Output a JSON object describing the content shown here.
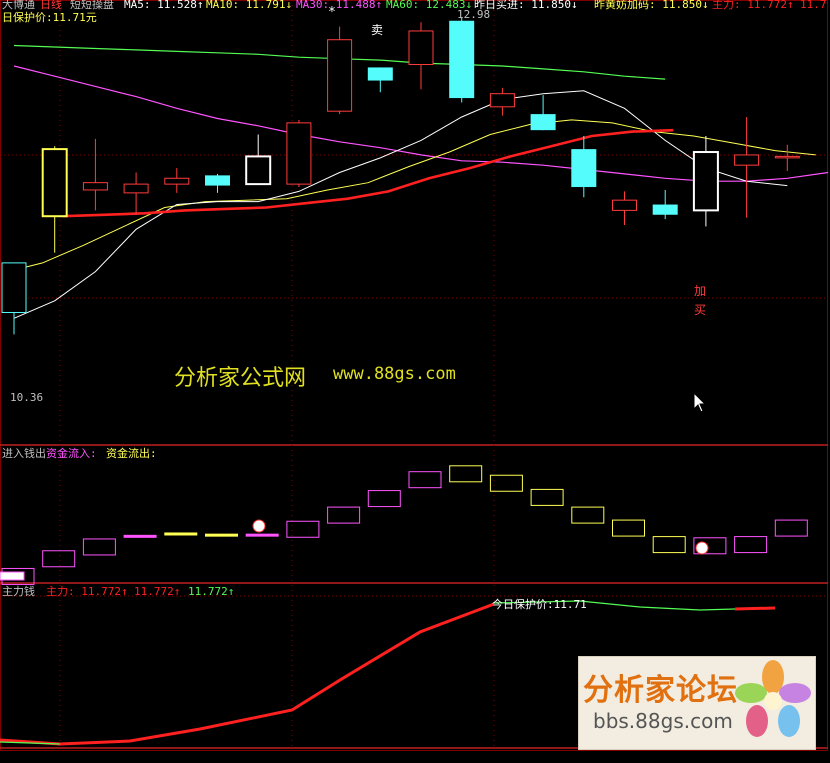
{
  "colors": {
    "up": "#ff3c3c",
    "down": "#54fcfc",
    "ma5": "#ffffff",
    "ma10": "#ffff54",
    "ma30": "#ff54ff",
    "ma60": "#54fc54",
    "red_line": "#ff2020",
    "grid": "#800000",
    "flow_in": "#ff54ff",
    "flow_out": "#ffff54",
    "zhuli": "#ff2020",
    "green": "#54fc54"
  },
  "header": {
    "title": "大博通",
    "period": "日线",
    "formula": "短短操盘",
    "ma5_label": "MA5: 11.528↑",
    "ma10_label": "MA10: 11.791↓",
    "ma30_label": "MA30: 11.488↑",
    "ma60_label": "MA60: 12.483↓",
    "buy_label": "昨日买进: 11.850↓",
    "add_label": "昨黄妨加码: 11.850↓",
    "zhuli_label": "主力: 11.772↑",
    "extra_label": "11.7",
    "protect_label": "日保护价:11.71元"
  },
  "annotations": {
    "sell": "卖",
    "add": "加",
    "buy": "买",
    "star": "*",
    "high": "12.98",
    "low": "10.36"
  },
  "panel2": {
    "title": "进入钱出",
    "in_label": "资金流入:",
    "out_label": "资金流出:"
  },
  "panel3": {
    "title": "主力钱",
    "v1": "主力: 11.772↑",
    "v2": "11.772↑",
    "v3": "11.772↑",
    "protect": "今日保护价:11.71"
  },
  "watermark": {
    "text": "分析家公式网",
    "url": "www.88gs.com"
  },
  "logo": {
    "title": "分析家论坛",
    "url": "bbs.88gs.com"
  },
  "chart_data": {
    "type": "candlestick",
    "candles": [
      {
        "o": 11.3,
        "c": 10.96,
        "h": 11.3,
        "l": 10.81
      },
      {
        "o": 11.62,
        "c": 12.08,
        "h": 12.1,
        "l": 11.37,
        "yellow": true
      },
      {
        "o": 11.8,
        "c": 11.85,
        "h": 12.15,
        "l": 11.66
      },
      {
        "o": 11.78,
        "c": 11.84,
        "h": 11.92,
        "l": 11.63
      },
      {
        "o": 11.84,
        "c": 11.88,
        "h": 11.95,
        "l": 11.78
      },
      {
        "o": 11.9,
        "c": 11.83,
        "h": 11.91,
        "l": 11.78,
        "cyan": true
      },
      {
        "o": 11.84,
        "c": 12.03,
        "h": 12.18,
        "l": 11.84,
        "white": true
      },
      {
        "o": 11.84,
        "c": 12.26,
        "h": 12.28,
        "l": 11.82
      },
      {
        "o": 12.34,
        "c": 12.83,
        "h": 12.92,
        "l": 12.32
      },
      {
        "o": 12.64,
        "c": 12.55,
        "h": 12.64,
        "l": 12.47,
        "cyan": true
      },
      {
        "o": 12.66,
        "c": 12.89,
        "h": 12.95,
        "l": 12.49
      },
      {
        "o": 12.96,
        "c": 12.43,
        "h": 12.98,
        "l": 12.4,
        "cyan": true
      },
      {
        "o": 12.37,
        "c": 12.46,
        "h": 12.5,
        "l": 12.31
      },
      {
        "o": 12.32,
        "c": 12.21,
        "h": 12.45,
        "l": 12.21,
        "cyan": true
      },
      {
        "o": 12.08,
        "c": 11.82,
        "h": 12.17,
        "l": 11.75,
        "cyan": true
      },
      {
        "o": 11.66,
        "c": 11.73,
        "h": 11.79,
        "l": 11.56
      },
      {
        "o": 11.7,
        "c": 11.63,
        "h": 11.8,
        "l": 11.6,
        "cyan": true
      },
      {
        "o": 11.66,
        "c": 12.06,
        "h": 12.17,
        "l": 11.55,
        "white": true
      },
      {
        "o": 11.97,
        "c": 12.04,
        "h": 12.3,
        "l": 11.61
      },
      {
        "o": 12.02,
        "c": 12.03,
        "h": 12.11,
        "l": 11.93
      }
    ],
    "ma5": [
      10.92,
      11.04,
      11.24,
      11.53,
      11.7,
      11.72,
      11.72,
      11.79,
      11.92,
      12.02,
      12.14,
      12.3,
      12.42,
      12.46,
      12.48,
      12.36,
      12.14,
      11.95,
      11.86,
      11.83
    ],
    "ma10": [
      11.23,
      11.3,
      11.42,
      11.55,
      11.68,
      11.72,
      11.73,
      11.74,
      11.8,
      11.85,
      11.96,
      12.06,
      12.18,
      12.25,
      12.28,
      12.26,
      12.2,
      12.17,
      12.12,
      12.07,
      12.04
    ],
    "ma30": [
      12.65,
      12.58,
      12.51,
      12.44,
      12.36,
      12.29,
      12.24,
      12.18,
      12.13,
      12.09,
      12.04,
      12.0,
      11.99,
      11.97,
      11.94,
      11.91,
      11.88,
      11.86,
      11.86,
      11.88,
      11.92
    ],
    "ma60": [
      12.79,
      12.78,
      12.77,
      12.76,
      12.75,
      12.74,
      12.73,
      12.71,
      12.7,
      12.69,
      12.67,
      12.66,
      12.65,
      12.63,
      12.61,
      12.58,
      12.56
    ],
    "zhuli": [
      11.62,
      11.63,
      11.64,
      11.66,
      11.67,
      11.68,
      11.71,
      11.74,
      11.79,
      11.88,
      11.95,
      12.03,
      12.1,
      12.17,
      12.2,
      12.21
    ],
    "flow": [
      {
        "v": 0.03,
        "in": true
      },
      {
        "v": 0.18,
        "in": true
      },
      {
        "v": 0.28,
        "in": true
      },
      {
        "v": 0.37,
        "in": true
      },
      {
        "v": 0.39,
        "in": false
      },
      {
        "v": 0.38,
        "in": false
      },
      {
        "v": 0.38,
        "in": true
      },
      {
        "v": 0.43,
        "in": true
      },
      {
        "v": 0.55,
        "in": true
      },
      {
        "v": 0.69,
        "in": true
      },
      {
        "v": 0.85,
        "in": true
      },
      {
        "v": 0.9,
        "in": false
      },
      {
        "v": 0.82,
        "in": false
      },
      {
        "v": 0.7,
        "in": false
      },
      {
        "v": 0.55,
        "in": false
      },
      {
        "v": 0.44,
        "in": false
      },
      {
        "v": 0.3,
        "in": false
      },
      {
        "v": 0.29,
        "in": true
      },
      {
        "v": 0.3,
        "in": true
      },
      {
        "v": 0.44,
        "in": true
      }
    ]
  }
}
